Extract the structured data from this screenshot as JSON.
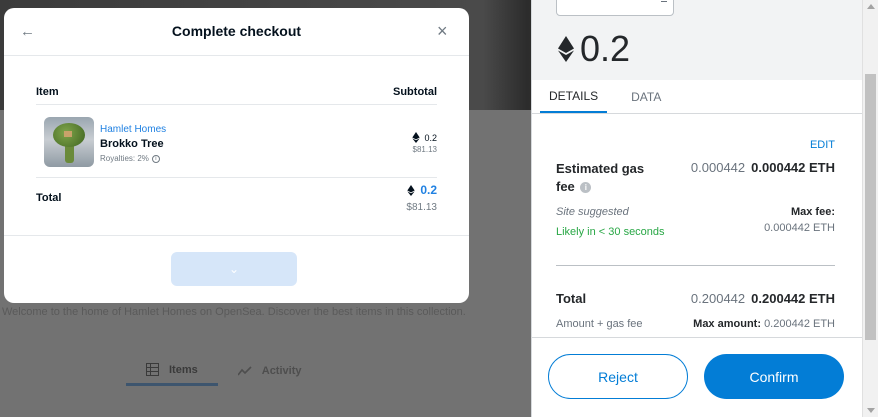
{
  "background": {
    "description_text": "Welcome to the home of Hamlet Homes on OpenSea. Discover the best items in this collection.",
    "tabs": [
      {
        "label": "Items",
        "icon": "grid-icon",
        "active": true
      },
      {
        "label": "Activity",
        "icon": "activity-icon",
        "active": false
      }
    ]
  },
  "checkout": {
    "title": "Complete checkout",
    "columns": {
      "item": "Item",
      "subtotal": "Subtotal"
    },
    "item": {
      "collection": "Hamlet Homes",
      "name": "Brokko Tree",
      "royalties": "Royalties: 2%",
      "price": "0.2",
      "usd": "$81.13"
    },
    "total": {
      "label": "Total",
      "price": "0.2",
      "usd": "$81.13"
    }
  },
  "metamask": {
    "amount": "0.2",
    "tabs": [
      "DETAILS",
      "DATA"
    ],
    "edit_label": "EDIT",
    "gas": {
      "label": "Estimated gas fee",
      "secondary": "0.000442",
      "primary": "0.000442 ETH",
      "site_suggested": "Site suggested",
      "likely": "Likely in < 30 seconds",
      "max_fee_label": "Max fee:",
      "max_fee_value": "0.000442 ETH"
    },
    "total": {
      "label": "Total",
      "secondary": "0.200442",
      "primary": "0.200442 ETH",
      "amount_gas_label": "Amount + gas fee",
      "max_amount_label": "Max amount:",
      "max_amount_value": "0.200442 ETH"
    },
    "buttons": {
      "reject": "Reject",
      "confirm": "Confirm"
    }
  },
  "colors": {
    "opensea_blue": "#2081e2",
    "metamask_blue": "#037dd6",
    "success_green": "#28a745"
  }
}
